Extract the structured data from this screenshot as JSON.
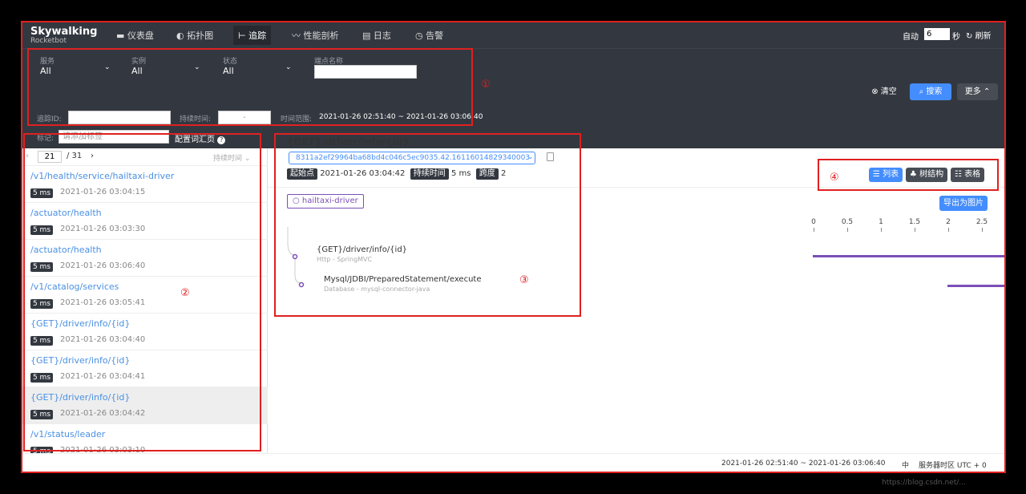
{
  "brand": {
    "name": "Skywalking",
    "sub": "Rocketbot"
  },
  "nav": [
    {
      "icon": "dashboard-icon",
      "label": "仪表盘"
    },
    {
      "icon": "topology-icon",
      "label": "拓扑图"
    },
    {
      "icon": "trace-icon",
      "label": "追踪"
    },
    {
      "icon": "profile-icon",
      "label": "性能剖析"
    },
    {
      "icon": "log-icon",
      "label": "日志"
    },
    {
      "icon": "alarm-icon",
      "label": "告警"
    }
  ],
  "auto": {
    "label": "自动",
    "value": "6",
    "unit": "秒",
    "refresh": "刷新"
  },
  "filters": {
    "service": {
      "label": "服务",
      "value": "All"
    },
    "instance": {
      "label": "实例",
      "value": "All"
    },
    "status": {
      "label": "状态",
      "value": "All"
    },
    "endpoint": {
      "label": "端点名称"
    },
    "trace_id": {
      "label": "追踪ID:"
    },
    "duration": {
      "label": "持续时间:",
      "sep": "-"
    },
    "time_range": {
      "label": "时间范围:",
      "value": "2021-01-26 02:51:40 ~ 2021-01-26 03:06:40"
    },
    "tag": {
      "label": "标记:",
      "placeholder": "请添加标签"
    },
    "config": "配置词汇页"
  },
  "buttons": {
    "clear": "清空",
    "search": "搜索",
    "more": "更多"
  },
  "pagination": {
    "page": "21",
    "total": "/ 31",
    "sort": "持续时间"
  },
  "traces": [
    {
      "endpoint": "/v1/health/service/hailtaxi-driver",
      "duration": "5 ms",
      "time": "2021-01-26 03:04:15"
    },
    {
      "endpoint": "/actuator/health",
      "duration": "5 ms",
      "time": "2021-01-26 03:03:30"
    },
    {
      "endpoint": "/actuator/health",
      "duration": "5 ms",
      "time": "2021-01-26 03:06:40"
    },
    {
      "endpoint": "/v1/catalog/services",
      "duration": "5 ms",
      "time": "2021-01-26 03:05:41"
    },
    {
      "endpoint": "{GET}/driver/info/{id}",
      "duration": "5 ms",
      "time": "2021-01-26 03:04:40"
    },
    {
      "endpoint": "{GET}/driver/info/{id}",
      "duration": "5 ms",
      "time": "2021-01-26 03:04:41"
    },
    {
      "endpoint": "{GET}/driver/info/{id}",
      "duration": "5 ms",
      "time": "2021-01-26 03:04:42"
    },
    {
      "endpoint": "/v1/status/leader",
      "duration": "5 ms",
      "time": "2021-01-26 03:03:10"
    }
  ],
  "detail": {
    "title": "{GET}/driver/info/{id}",
    "trace_id": "8311a2ef29964ba68bd4c046c5ec9035.42.16116014829340003",
    "start_label": "起始点",
    "start": "2021-01-26 03:04:42",
    "duration_label": "持续时间",
    "duration": "5 ms",
    "span_label": "跨度",
    "span": "2",
    "service": "hailtaxi-driver",
    "spans": [
      {
        "name": "{GET}/driver/info/{id}",
        "sub": "Http - SpringMVC"
      },
      {
        "name": "Mysql/JDBI/PreparedStatement/execute",
        "sub": "Database - mysql-connector-java"
      }
    ]
  },
  "views": {
    "list": "列表",
    "tree": "树结构",
    "table": "表格",
    "export": "导出为图片"
  },
  "axis_ticks": [
    "0",
    "0.5",
    "1",
    "1.5",
    "2",
    "2.5"
  ],
  "annotations": {
    "a1": "①",
    "a2": "②",
    "a3": "③",
    "a4": "④"
  },
  "footer": {
    "range": "2021-01-26 02:51:40 ~ 2021-01-26 03:06:40",
    "lang": "中",
    "tz": "服务器时区 UTC + 0"
  },
  "watermark": "https://blog.csdn.net/..."
}
